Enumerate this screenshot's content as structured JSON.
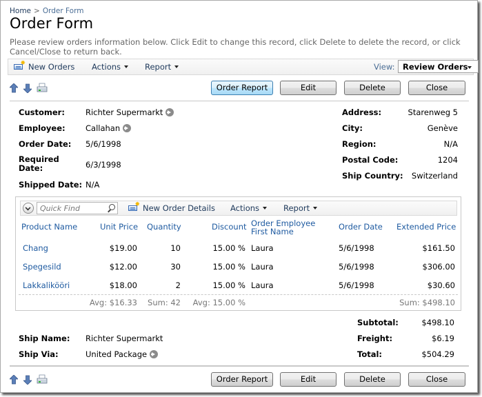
{
  "breadcrumb": {
    "home": "Home",
    "separator": ">",
    "current": "Order Form"
  },
  "page": {
    "title": "Order Form",
    "description": "Please review orders information below. Click Edit to change this record, click Delete to delete the record, or click Cancel/Close to return back."
  },
  "toolbar": {
    "new_label": "New Orders",
    "actions_label": "Actions",
    "report_label": "Report",
    "view_label": "View:",
    "view_selected": "Review Orders"
  },
  "buttons": {
    "order_report": "Order Report",
    "edit": "Edit",
    "delete": "Delete",
    "close": "Close"
  },
  "icons": {
    "move_up": "arrow-up-icon",
    "move_down": "arrow-down-icon",
    "print": "printer-icon",
    "lookup": "go-arrow-icon",
    "new": "new-record-icon",
    "search": "search-icon",
    "collapse": "collapse-icon"
  },
  "fields": {
    "customer": {
      "label": "Customer:",
      "value": "Richter Supermarkt"
    },
    "employee": {
      "label": "Employee:",
      "value": "Callahan"
    },
    "order_date": {
      "label": "Order Date:",
      "value": "5/6/1998"
    },
    "required_date": {
      "label_line1": "Required",
      "label_line2": "Date:",
      "value": "6/3/1998"
    },
    "shipped_date": {
      "label": "Shipped Date:",
      "value": "N/A"
    },
    "address": {
      "label": "Address:",
      "value": "Starenweg 5"
    },
    "city": {
      "label": "City:",
      "value": "Genève"
    },
    "region": {
      "label": "Region:",
      "value": "N/A"
    },
    "postal_code": {
      "label": "Postal Code:",
      "value": "1204"
    },
    "ship_country": {
      "label": "Ship Country:",
      "value": "Switzerland"
    },
    "subtotal": {
      "label": "Subtotal:",
      "value": "$498.10"
    },
    "freight": {
      "label": "Freight:",
      "value": "$6.19"
    },
    "total": {
      "label": "Total:",
      "value": "$504.29"
    },
    "ship_name": {
      "label": "Ship Name:",
      "value": "Richter Supermarkt"
    },
    "ship_via": {
      "label": "Ship Via:",
      "value": "United Package"
    }
  },
  "details": {
    "quick_find_placeholder": "Quick Find",
    "new_label": "New Order Details",
    "actions_label": "Actions",
    "report_label": "Report",
    "columns": [
      "Product Name",
      "Unit Price",
      "Quantity",
      "Discount",
      "Order Employee First Name",
      "Order Date",
      "Extended Price"
    ],
    "column_employee_line1": "Order Employee",
    "column_employee_line2": "First Name",
    "rows": [
      {
        "product": "Chang",
        "unit_price": "$19.00",
        "quantity": "10",
        "discount": "15.00 %",
        "employee": "Laura",
        "order_date": "5/6/1998",
        "extended_price": "$161.50"
      },
      {
        "product": "Spegesild",
        "unit_price": "$12.00",
        "quantity": "30",
        "discount": "15.00 %",
        "employee": "Laura",
        "order_date": "5/6/1998",
        "extended_price": "$306.00"
      },
      {
        "product": "Lakkalikööri",
        "unit_price": "$18.00",
        "quantity": "2",
        "discount": "15.00 %",
        "employee": "Laura",
        "order_date": "5/6/1998",
        "extended_price": "$30.60"
      }
    ],
    "aggregates": {
      "unit_price": "Avg: $16.33",
      "quantity": "Sum: 42",
      "discount": "Avg: 15.00 %",
      "extended_price": "Sum: $498.10"
    }
  },
  "colors": {
    "link": "#1e5aa0",
    "primary_button": "#bee6fd",
    "toolbar_bg": "#f0f0f0",
    "description_text": "#666666"
  }
}
